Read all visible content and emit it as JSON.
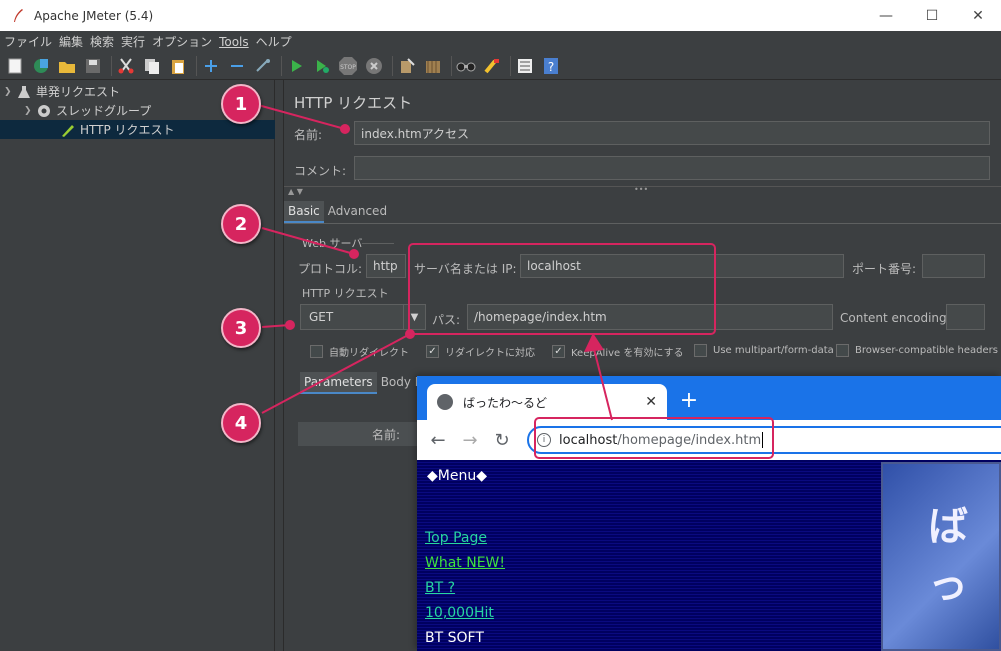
{
  "window": {
    "title": "Apache JMeter (5.4)",
    "minimize": "—",
    "maximize": "☐",
    "close": "✕"
  },
  "menu": [
    "ファイル",
    "編集",
    "検索",
    "実行",
    "オプション",
    "Tools",
    "ヘルプ"
  ],
  "toolbar_icons": [
    "new-icon",
    "templates-icon",
    "open-icon",
    "save-icon",
    "cut-icon",
    "copy-icon",
    "paste-icon",
    "expand-icon",
    "collapse-icon",
    "toggle-icon",
    "start-icon",
    "start-no-pause-icon",
    "stop-icon",
    "shutdown-icon",
    "clear-icon",
    "clear-all-icon",
    "search-icon",
    "reset-search-icon",
    "function-helper-icon",
    "help-icon"
  ],
  "tree": {
    "items": [
      {
        "label": "単発リクエスト"
      },
      {
        "label": "スレッドグループ"
      },
      {
        "label": "HTTP リクエスト"
      }
    ]
  },
  "sampler": {
    "title": "HTTP リクエスト",
    "name_label": "名前:",
    "name_value": "index.htmアクセス",
    "comment_label": "コメント:",
    "comment_value": "",
    "tabs": [
      "Basic",
      "Advanced"
    ],
    "web_server_group": "Web サーバ",
    "protocol_label": "プロトコル:",
    "protocol_value": "http",
    "server_label": "サーバ名または IP:",
    "server_value": "localhost",
    "port_label": "ポート番号:",
    "port_value": "",
    "http_request_group": "HTTP リクエスト",
    "method_value": "GET",
    "path_label": "パス:",
    "path_value": "/homepage/index.htm",
    "encoding_label": "Content encoding:",
    "encoding_value": "",
    "checkboxes": [
      {
        "label": "自動リダイレクト",
        "checked": false
      },
      {
        "label": "リダイレクトに対応",
        "checked": true
      },
      {
        "label": "KeepAlive を有効にする",
        "checked": true
      },
      {
        "label": "Use multipart/form-data",
        "checked": false
      },
      {
        "label": "Browser-compatible headers",
        "checked": false
      }
    ],
    "param_tabs": [
      "Parameters",
      "Body Data"
    ],
    "param_header_name": "名前:"
  },
  "browser": {
    "tab_title": "ばったわ～るど",
    "tab_close": "✕",
    "new_tab": "+",
    "url_host": "localhost",
    "url_path": "/homepage/index.htm",
    "page": {
      "menu_title": "◆Menu◆",
      "links": [
        {
          "label": "Top Page",
          "color": "#27d6a0"
        },
        {
          "label": "What NEW!",
          "color": "#3fe03f"
        },
        {
          "label": "BT ?",
          "color": "#27d6a0"
        },
        {
          "label": "10,000Hit",
          "color": "#27d6a0"
        },
        {
          "label": "BT SOFT",
          "color": "#ffffff"
        }
      ],
      "hero_text": "ばっ"
    }
  },
  "callouts": [
    "1",
    "2",
    "3",
    "4"
  ],
  "colors": {
    "accent": "#d6255f",
    "selection": "#0d293e",
    "browser_blue": "#1a73e8"
  }
}
